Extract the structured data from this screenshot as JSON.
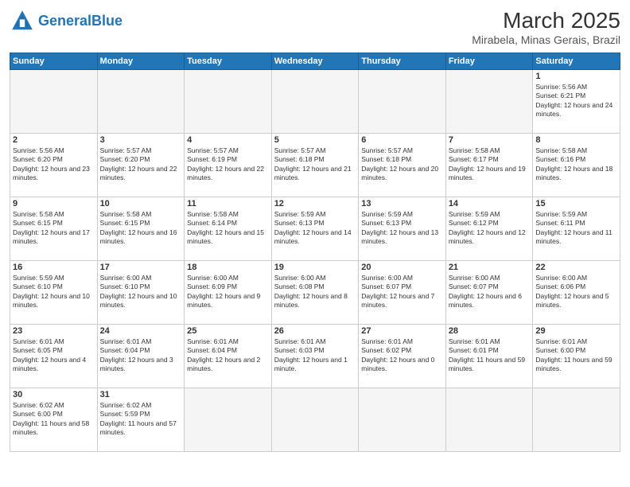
{
  "header": {
    "logo_general": "General",
    "logo_blue": "Blue",
    "month_year": "March 2025",
    "location": "Mirabela, Minas Gerais, Brazil"
  },
  "weekdays": [
    "Sunday",
    "Monday",
    "Tuesday",
    "Wednesday",
    "Thursday",
    "Friday",
    "Saturday"
  ],
  "weeks": [
    [
      {
        "day": "",
        "info": ""
      },
      {
        "day": "",
        "info": ""
      },
      {
        "day": "",
        "info": ""
      },
      {
        "day": "",
        "info": ""
      },
      {
        "day": "",
        "info": ""
      },
      {
        "day": "",
        "info": ""
      },
      {
        "day": "1",
        "info": "Sunrise: 5:56 AM\nSunset: 6:21 PM\nDaylight: 12 hours and 24 minutes."
      }
    ],
    [
      {
        "day": "2",
        "info": "Sunrise: 5:56 AM\nSunset: 6:20 PM\nDaylight: 12 hours and 23 minutes."
      },
      {
        "day": "3",
        "info": "Sunrise: 5:57 AM\nSunset: 6:20 PM\nDaylight: 12 hours and 22 minutes."
      },
      {
        "day": "4",
        "info": "Sunrise: 5:57 AM\nSunset: 6:19 PM\nDaylight: 12 hours and 22 minutes."
      },
      {
        "day": "5",
        "info": "Sunrise: 5:57 AM\nSunset: 6:18 PM\nDaylight: 12 hours and 21 minutes."
      },
      {
        "day": "6",
        "info": "Sunrise: 5:57 AM\nSunset: 6:18 PM\nDaylight: 12 hours and 20 minutes."
      },
      {
        "day": "7",
        "info": "Sunrise: 5:58 AM\nSunset: 6:17 PM\nDaylight: 12 hours and 19 minutes."
      },
      {
        "day": "8",
        "info": "Sunrise: 5:58 AM\nSunset: 6:16 PM\nDaylight: 12 hours and 18 minutes."
      }
    ],
    [
      {
        "day": "9",
        "info": "Sunrise: 5:58 AM\nSunset: 6:15 PM\nDaylight: 12 hours and 17 minutes."
      },
      {
        "day": "10",
        "info": "Sunrise: 5:58 AM\nSunset: 6:15 PM\nDaylight: 12 hours and 16 minutes."
      },
      {
        "day": "11",
        "info": "Sunrise: 5:58 AM\nSunset: 6:14 PM\nDaylight: 12 hours and 15 minutes."
      },
      {
        "day": "12",
        "info": "Sunrise: 5:59 AM\nSunset: 6:13 PM\nDaylight: 12 hours and 14 minutes."
      },
      {
        "day": "13",
        "info": "Sunrise: 5:59 AM\nSunset: 6:13 PM\nDaylight: 12 hours and 13 minutes."
      },
      {
        "day": "14",
        "info": "Sunrise: 5:59 AM\nSunset: 6:12 PM\nDaylight: 12 hours and 12 minutes."
      },
      {
        "day": "15",
        "info": "Sunrise: 5:59 AM\nSunset: 6:11 PM\nDaylight: 12 hours and 11 minutes."
      }
    ],
    [
      {
        "day": "16",
        "info": "Sunrise: 5:59 AM\nSunset: 6:10 PM\nDaylight: 12 hours and 10 minutes."
      },
      {
        "day": "17",
        "info": "Sunrise: 6:00 AM\nSunset: 6:10 PM\nDaylight: 12 hours and 10 minutes."
      },
      {
        "day": "18",
        "info": "Sunrise: 6:00 AM\nSunset: 6:09 PM\nDaylight: 12 hours and 9 minutes."
      },
      {
        "day": "19",
        "info": "Sunrise: 6:00 AM\nSunset: 6:08 PM\nDaylight: 12 hours and 8 minutes."
      },
      {
        "day": "20",
        "info": "Sunrise: 6:00 AM\nSunset: 6:07 PM\nDaylight: 12 hours and 7 minutes."
      },
      {
        "day": "21",
        "info": "Sunrise: 6:00 AM\nSunset: 6:07 PM\nDaylight: 12 hours and 6 minutes."
      },
      {
        "day": "22",
        "info": "Sunrise: 6:00 AM\nSunset: 6:06 PM\nDaylight: 12 hours and 5 minutes."
      }
    ],
    [
      {
        "day": "23",
        "info": "Sunrise: 6:01 AM\nSunset: 6:05 PM\nDaylight: 12 hours and 4 minutes."
      },
      {
        "day": "24",
        "info": "Sunrise: 6:01 AM\nSunset: 6:04 PM\nDaylight: 12 hours and 3 minutes."
      },
      {
        "day": "25",
        "info": "Sunrise: 6:01 AM\nSunset: 6:04 PM\nDaylight: 12 hours and 2 minutes."
      },
      {
        "day": "26",
        "info": "Sunrise: 6:01 AM\nSunset: 6:03 PM\nDaylight: 12 hours and 1 minute."
      },
      {
        "day": "27",
        "info": "Sunrise: 6:01 AM\nSunset: 6:02 PM\nDaylight: 12 hours and 0 minutes."
      },
      {
        "day": "28",
        "info": "Sunrise: 6:01 AM\nSunset: 6:01 PM\nDaylight: 11 hours and 59 minutes."
      },
      {
        "day": "29",
        "info": "Sunrise: 6:01 AM\nSunset: 6:00 PM\nDaylight: 11 hours and 59 minutes."
      }
    ],
    [
      {
        "day": "30",
        "info": "Sunrise: 6:02 AM\nSunset: 6:00 PM\nDaylight: 11 hours and 58 minutes."
      },
      {
        "day": "31",
        "info": "Sunrise: 6:02 AM\nSunset: 5:59 PM\nDaylight: 11 hours and 57 minutes."
      },
      {
        "day": "",
        "info": ""
      },
      {
        "day": "",
        "info": ""
      },
      {
        "day": "",
        "info": ""
      },
      {
        "day": "",
        "info": ""
      },
      {
        "day": "",
        "info": ""
      }
    ]
  ]
}
